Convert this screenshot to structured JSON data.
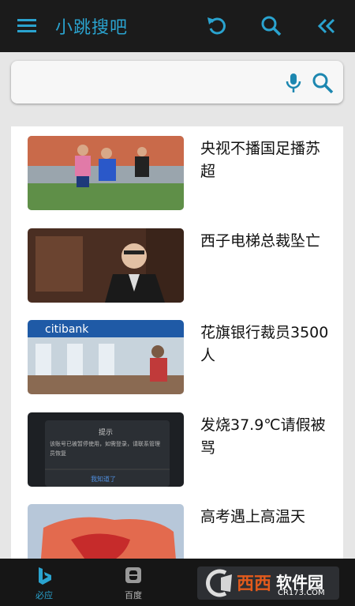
{
  "app": {
    "title": "小跳搜吧"
  },
  "toolbar": {
    "icons": [
      "menu-icon",
      "refresh-icon",
      "search-icon",
      "double-chevron-left-icon"
    ]
  },
  "search": {
    "value": "",
    "placeholder": ""
  },
  "news": [
    {
      "title": "央视不播国足播苏超"
    },
    {
      "title": "西子电梯总裁坠亡"
    },
    {
      "title": "花旗银行裁员3500人"
    },
    {
      "title": "发烧37.9℃请假被骂"
    },
    {
      "title": "高考遇上高温天"
    }
  ],
  "thumb_texts": {
    "bank_sign": "citibank",
    "dialog_title": "提示",
    "dialog_body": "该账号已被暂停使用，如需登录，请联系管理员恢复",
    "dialog_button": "我知道了"
  },
  "bottom_tabs": [
    {
      "label": "必应",
      "icon": "bing-icon",
      "active": true
    },
    {
      "label": "百度",
      "icon": "baidu-icon",
      "active": false
    }
  ],
  "watermark": {
    "brand": "西西",
    "site_label": "软件园",
    "domain": "CR173.COM"
  },
  "colors": {
    "accent": "#2aa3cf",
    "topbar": "#1b1b1b",
    "bottombar": "#161616"
  }
}
